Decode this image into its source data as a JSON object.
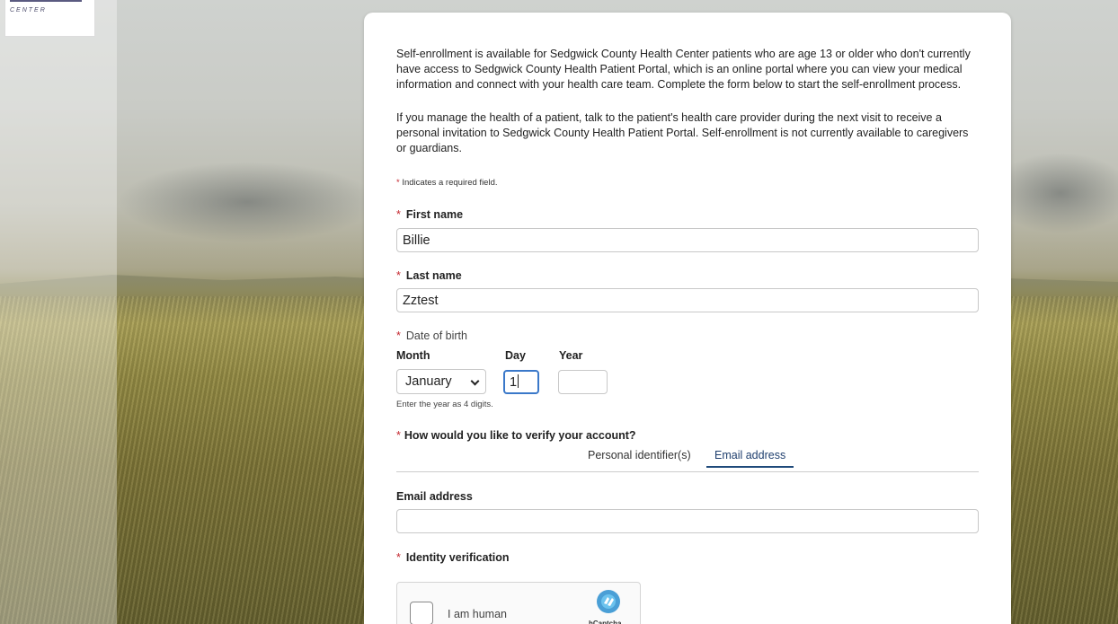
{
  "logo": {
    "text": "CENTER"
  },
  "intro": {
    "paragraph1": "Self-enrollment is available for Sedgwick County Health Center patients who are age 13 or older who don't currently have access to Sedgwick County Health Patient Portal, which is an online portal where you can view your medical information and connect with your health care team. Complete the form below to start the self-enrollment process.",
    "paragraph2": "If you manage the health of a patient, talk to the patient's health care provider during the next visit to receive a personal invitation to Sedgwick County Health Patient Portal. Self-enrollment is not currently available to caregivers or guardians."
  },
  "required_note": "Indicates a required field.",
  "asterisk": "*",
  "first_name": {
    "label": "First name",
    "value": "Billie"
  },
  "last_name": {
    "label": "Last name",
    "value": "Zztest"
  },
  "dob": {
    "label": "Date of birth",
    "month_label": "Month",
    "day_label": "Day",
    "year_label": "Year",
    "month_value": "January",
    "day_value": "1",
    "year_value": "",
    "hint": "Enter the year as 4 digits."
  },
  "verify": {
    "label": "How would you like to verify your account?",
    "tabs": [
      "Personal identifier(s)",
      "Email address"
    ],
    "active_tab": "Email address"
  },
  "email": {
    "label": "Email address",
    "value": ""
  },
  "identity": {
    "label": "Identity verification"
  },
  "captcha": {
    "label": "I am human",
    "brand": "hCaptcha"
  },
  "colors": {
    "accent": "#1f4a7a",
    "required": "#c4262e",
    "focus": "#3a78c9"
  }
}
